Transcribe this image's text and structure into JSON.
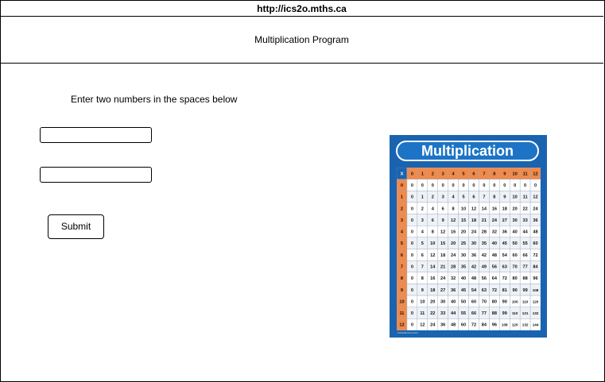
{
  "browser": {
    "url": "http://ics2o.mths.ca"
  },
  "header": {
    "title": "Multiplication Program"
  },
  "main": {
    "instructions": "Enter two numbers in the spaces below",
    "input1": {
      "value": "",
      "placeholder": ""
    },
    "input2": {
      "value": "",
      "placeholder": ""
    },
    "submit_label": "Submit"
  },
  "image": {
    "title": "Multiplication",
    "corner_label": "X",
    "max_factor": 12,
    "footer_text": "PosterEnvironment",
    "colors": {
      "background": "#1a63b0",
      "header_cells": "#f08a4b",
      "row_headers": "#f08a4b",
      "corner": "#1a63b0",
      "body_text": "#111111"
    }
  }
}
